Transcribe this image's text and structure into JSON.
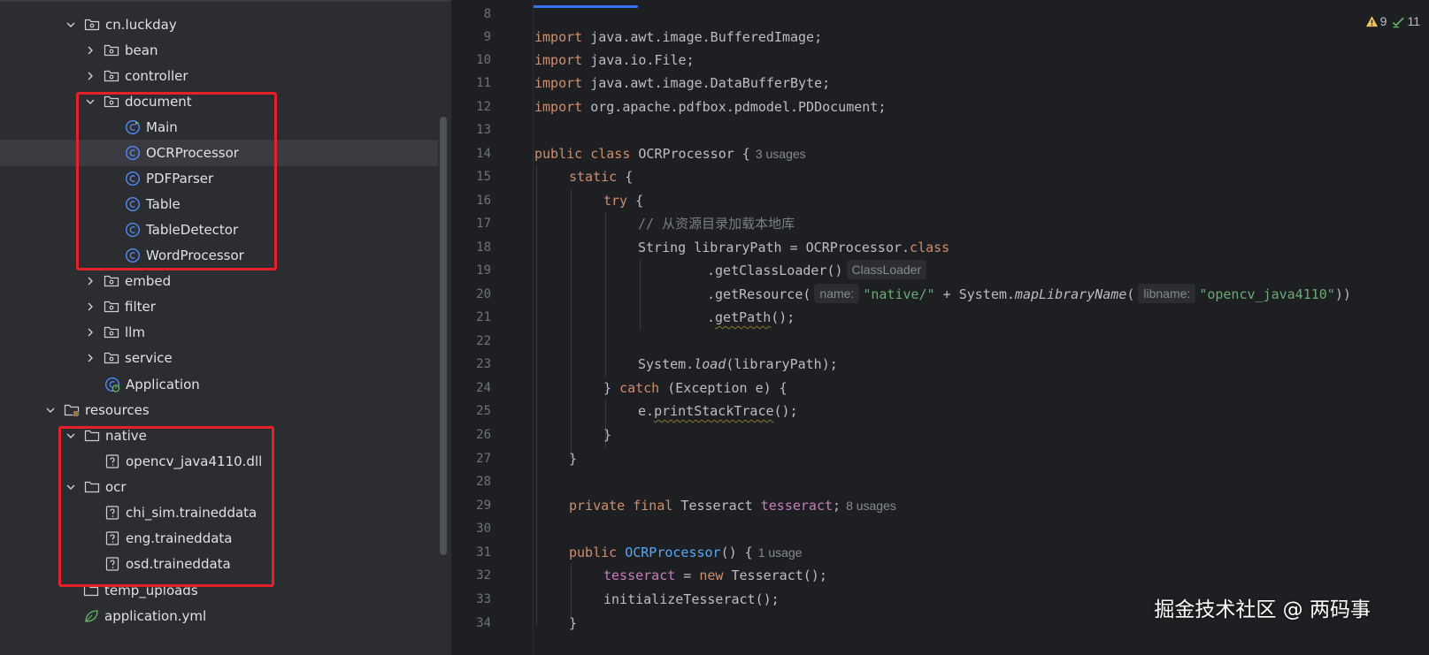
{
  "project_tree": {
    "items": [
      {
        "label": "cn.luckday",
        "kind": "package",
        "expanded": true
      },
      {
        "label": "bean",
        "kind": "package",
        "expanded": false
      },
      {
        "label": "controller",
        "kind": "package",
        "expanded": false
      },
      {
        "label": "document",
        "kind": "package",
        "expanded": true
      },
      {
        "label": "Main",
        "kind": "main-class"
      },
      {
        "label": "OCRProcessor",
        "kind": "class",
        "selected": true
      },
      {
        "label": "PDFParser",
        "kind": "class"
      },
      {
        "label": "Table",
        "kind": "class"
      },
      {
        "label": "TableDetector",
        "kind": "class"
      },
      {
        "label": "WordProcessor",
        "kind": "class"
      },
      {
        "label": "embed",
        "kind": "package",
        "expanded": false
      },
      {
        "label": "filter",
        "kind": "package",
        "expanded": false
      },
      {
        "label": "llm",
        "kind": "package",
        "expanded": false
      },
      {
        "label": "service",
        "kind": "package",
        "expanded": false
      },
      {
        "label": "Application",
        "kind": "spring-app-class"
      },
      {
        "label": "resources",
        "kind": "resources-folder",
        "expanded": true
      },
      {
        "label": "native",
        "kind": "folder",
        "expanded": true
      },
      {
        "label": "opencv_java4110.dll",
        "kind": "unknown-file"
      },
      {
        "label": "ocr",
        "kind": "folder",
        "expanded": true
      },
      {
        "label": "chi_sim.traineddata",
        "kind": "unknown-file"
      },
      {
        "label": "eng.traineddata",
        "kind": "unknown-file"
      },
      {
        "label": "osd.traineddata",
        "kind": "unknown-file"
      },
      {
        "label": "temp_uploads",
        "kind": "folder"
      },
      {
        "label": "application.yml",
        "kind": "yaml-file"
      }
    ]
  },
  "editor": {
    "line_numbers": [
      "8",
      "9",
      "10",
      "11",
      "12",
      "13",
      "14",
      "15",
      "16",
      "17",
      "18",
      "19",
      "20",
      "21",
      "22",
      "23",
      "24",
      "25",
      "26",
      "27",
      "28",
      "29",
      "30",
      "31",
      "32",
      "33",
      "34"
    ],
    "code": {
      "l9_kw": "import",
      "l9_rest": " java.awt.image.BufferedImage;",
      "l10_kw": "import",
      "l10_rest": " java.io.File;",
      "l11_kw": "import",
      "l11_rest": " java.awt.image.DataBufferByte;",
      "l12_kw": "import",
      "l12_rest": " org.apache.pdfbox.pdmodel.PDDocument;",
      "l14_kw": "public class",
      "l14_name": " OCRProcessor {",
      "l14_usage": "3 usages",
      "l15_kw": "static",
      "l15_rest": " {",
      "l16_kw": "try",
      "l16_rest": " {",
      "l17_comment": "// 从资源目录加载本地库",
      "l18_pre": "String libraryPath = OCRProcessor.",
      "l18_kw": "class",
      "l19_pre": ".getClassLoader()",
      "l19_hint": "ClassLoader",
      "l20_pre": ".getResource(",
      "l20_hint1": "name:",
      "l20_str1": "\"native/\"",
      "l20_mid": " + System.",
      "l20_method": "mapLibraryName",
      "l20_paren": "(",
      "l20_hint2": "libname:",
      "l20_str2": "\"opencv_java4110\"",
      "l20_end": "))",
      "l21_dot": ".",
      "l21_method": "getPath",
      "l21_end": "();",
      "l23_pre": "System.",
      "l23_method": "load",
      "l23_end": "(libraryPath);",
      "l24_pre": "} ",
      "l24_kw": "catch",
      "l24_end": " (Exception e) {",
      "l25_pre": "e.",
      "l25_method": "printStackTrace",
      "l25_end": "();",
      "l26": "}",
      "l27": "}",
      "l29_kw": "private final",
      "l29_type": " Tesseract ",
      "l29_field": "tesseract",
      "l29_end": ";",
      "l29_usage": "8 usages",
      "l31_kw": "public",
      "l31_name": "OCRProcessor",
      "l31_end": "() {",
      "l31_usage": "1 usage",
      "l32_field": "tesseract",
      "l32_mid": " = ",
      "l32_kw": "new",
      "l32_end": " Tesseract();",
      "l33": "initializeTesseract();",
      "l34": "}"
    },
    "inspections": {
      "warnings": "9",
      "weak_warnings": "11"
    }
  },
  "watermark": "掘金技术社区 @ 两码事",
  "colors": {
    "highlight_box": "#e5202b",
    "accent": "#3574f0",
    "keyword": "#cf8e6d",
    "string": "#6aab73",
    "field": "#c77dbb",
    "declaration": "#56a8f5",
    "comment": "#7a7e85"
  }
}
